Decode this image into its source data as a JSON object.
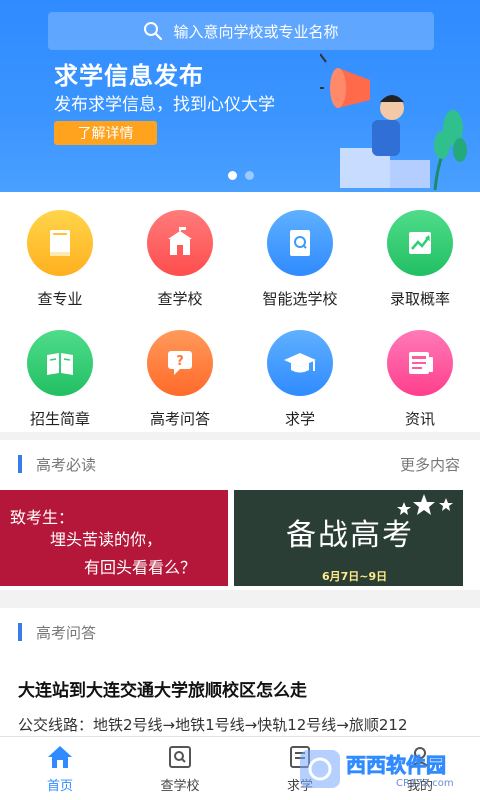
{
  "search": {
    "placeholder": "输入意向学校或专业名称"
  },
  "banner": {
    "headline": "求学信息发布",
    "subtitle": "发布求学信息，找到心仪大学",
    "button": "了解详情",
    "slides": 2,
    "active_slide": 1
  },
  "grid": [
    {
      "label": "查专业",
      "icon": "book-icon",
      "color": "#ffc23a"
    },
    {
      "label": "查学校",
      "icon": "school-building-icon",
      "color": "#ff5a5a"
    },
    {
      "label": "智能选学校",
      "icon": "search-book-icon",
      "color": "#3d9bff"
    },
    {
      "label": "录取概率",
      "icon": "trend-chart-icon",
      "color": "#2fcf73"
    },
    {
      "label": "招生简章",
      "icon": "open-book-icon",
      "color": "#2fcf73"
    },
    {
      "label": "高考问答",
      "icon": "question-bubble-icon",
      "color": "#ff7a3a"
    },
    {
      "label": "求学",
      "icon": "graduation-cap-icon",
      "color": "#3d9bff"
    },
    {
      "label": "资讯",
      "icon": "news-icon",
      "color": "#ff5ca0"
    }
  ],
  "section1": {
    "title": "高考必读",
    "more": "更多内容"
  },
  "cards": {
    "card1": {
      "line1": "致考生：",
      "line2": "埋头苦读的你，",
      "line3": "有回头看看么？"
    },
    "card2": {
      "title": "备战高考",
      "date": "6月7日~9日"
    }
  },
  "section2": {
    "title": "高考问答"
  },
  "qa": {
    "question": "大连站到大连交通大学旅顺校区怎么走",
    "answer": "公交线路：地铁2号线→地铁1号线→快轨12号线→旅顺212"
  },
  "nav": {
    "tabs": [
      {
        "label": "首页",
        "icon": "home-icon",
        "active": true
      },
      {
        "label": "查学校",
        "icon": "search-school-icon",
        "active": false
      },
      {
        "label": "求学",
        "icon": "study-icon",
        "active": false
      },
      {
        "label": "我的",
        "icon": "profile-icon",
        "active": false
      }
    ]
  },
  "watermark": {
    "text1": "西西软件园",
    "text2": "CR173.com"
  },
  "colors": {
    "primary": "#2f8bff",
    "accent": "#ffa21e",
    "section_bar": "#3a7bea"
  }
}
